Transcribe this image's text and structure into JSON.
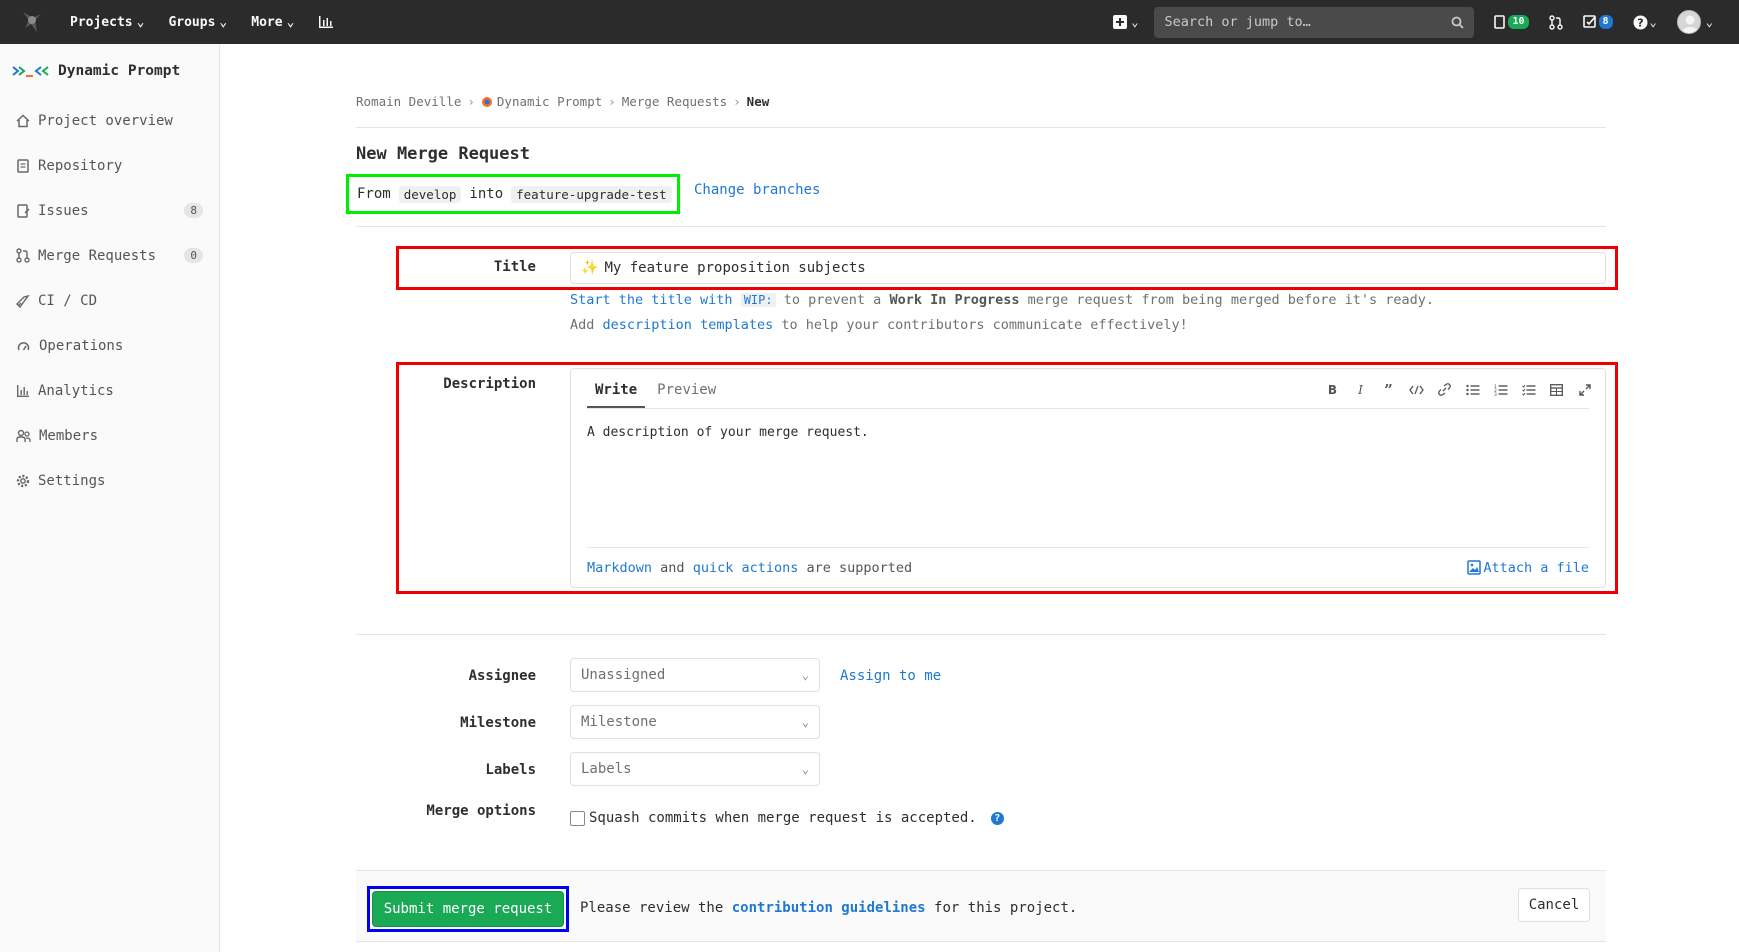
{
  "navbar": {
    "projects": "Projects",
    "groups": "Groups",
    "more": "More",
    "search_placeholder": "Search or jump to…",
    "issues_count": "10",
    "todos_count": "8"
  },
  "sidebar": {
    "project_name": "Dynamic Prompt",
    "items": [
      {
        "label": "Project overview"
      },
      {
        "label": "Repository"
      },
      {
        "label": "Issues",
        "count": "8"
      },
      {
        "label": "Merge Requests",
        "count": "0"
      },
      {
        "label": "CI / CD"
      },
      {
        "label": "Operations"
      },
      {
        "label": "Analytics"
      },
      {
        "label": "Members"
      },
      {
        "label": "Settings"
      }
    ]
  },
  "breadcrumb": {
    "user": "Romain Deville",
    "project": "Dynamic Prompt",
    "section": "Merge Requests",
    "current": "New"
  },
  "page": {
    "title": "New Merge Request",
    "from_label": "From",
    "source_branch": "develop",
    "into_label": "into",
    "target_branch": "feature-upgrade-test",
    "change_branches": "Change branches"
  },
  "form": {
    "title_label": "Title",
    "title_value": "My feature proposition subjects",
    "help_start": "Start the title with",
    "help_wip": "WIP:",
    "help_mid": "to prevent a",
    "help_wip_strong": "Work In Progress",
    "help_end": "merge request from being merged before it's ready.",
    "help2_add": "Add",
    "help2_link": "description templates",
    "help2_end": "to help your contributors communicate effectively!",
    "description_label": "Description",
    "tab_write": "Write",
    "tab_preview": "Preview",
    "description_placeholder": "A description of your merge request.",
    "markdown_link": "Markdown",
    "and": "and",
    "quick_actions_link": "quick actions",
    "supported": "are supported",
    "attach_file": "Attach a file",
    "assignee_label": "Assignee",
    "assignee_value": "Unassigned",
    "assign_to_me": "Assign to me",
    "milestone_label": "Milestone",
    "milestone_value": "Milestone",
    "labels_label": "Labels",
    "labels_value": "Labels",
    "merge_options_label": "Merge options",
    "squash_label": "Squash commits when merge request is accepted."
  },
  "footer": {
    "submit": "Submit merge request",
    "review_pre": "Please review the",
    "review_link": "contribution guidelines",
    "review_post": "for this project.",
    "cancel": "Cancel"
  },
  "colors": {
    "navbar_bg": "#2b2b2b",
    "link": "#1f78d1",
    "success": "#1aaa55",
    "highlight_green": "#00ee00",
    "highlight_red": "#ee0000",
    "highlight_blue": "#0000ee"
  }
}
